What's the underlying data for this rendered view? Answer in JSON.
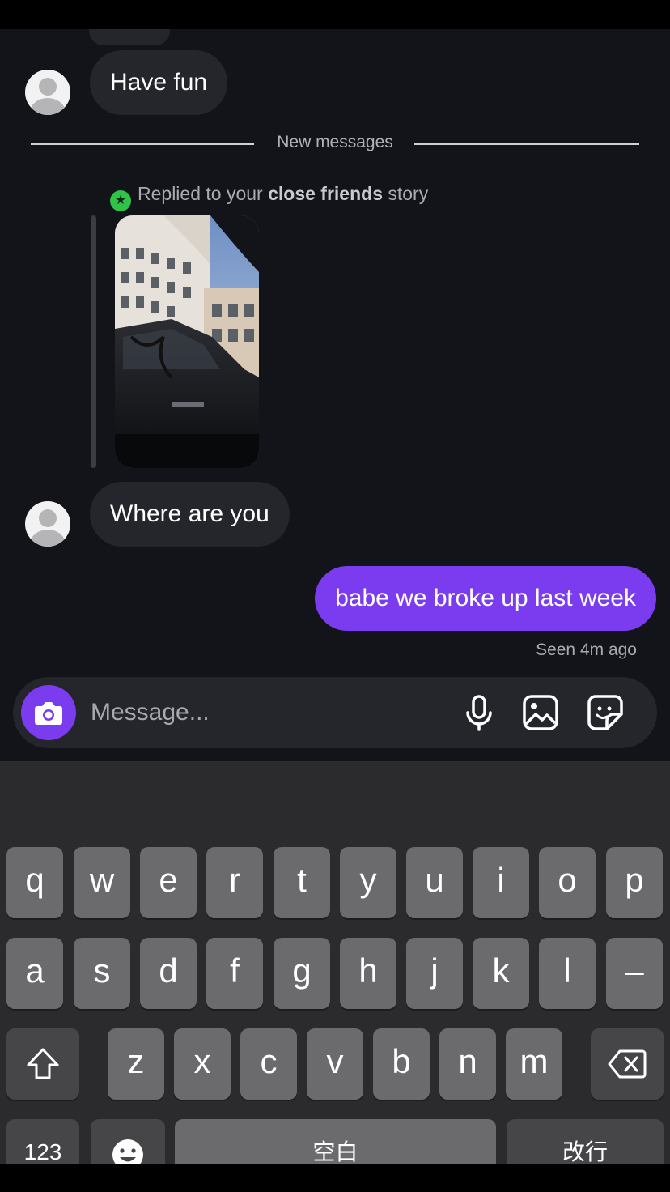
{
  "messages": {
    "incoming_1": "Have fun",
    "new_messages_label": "New messages",
    "story_reply": {
      "prefix": "Replied to your ",
      "bold": "close friends",
      "suffix": " story"
    },
    "incoming_2": "Where are you",
    "outgoing_1": "babe we broke up last week",
    "seen_status": "Seen 4m ago"
  },
  "composer": {
    "placeholder": "Message...",
    "icons": [
      "camera-icon",
      "microphone-icon",
      "gallery-icon",
      "sticker-icon"
    ]
  },
  "keyboard": {
    "row1": [
      "q",
      "w",
      "e",
      "r",
      "t",
      "y",
      "u",
      "i",
      "o",
      "p"
    ],
    "row2": [
      "a",
      "s",
      "d",
      "f",
      "g",
      "h",
      "j",
      "k",
      "l",
      "–"
    ],
    "row3": [
      "z",
      "x",
      "c",
      "v",
      "b",
      "n",
      "m"
    ],
    "numbers_key": "123",
    "space_key": "空白",
    "return_key": "改行",
    "icons": [
      "shift-icon",
      "backspace-icon",
      "emoji-icon"
    ]
  },
  "colors": {
    "background": "#121419",
    "incoming_bubble": "#24262b",
    "outgoing_bubble": "#7b3cf0",
    "close_friends_badge": "#2fc34a",
    "keyboard_bg": "#2b2b2d",
    "key": "#6b6b6e"
  }
}
